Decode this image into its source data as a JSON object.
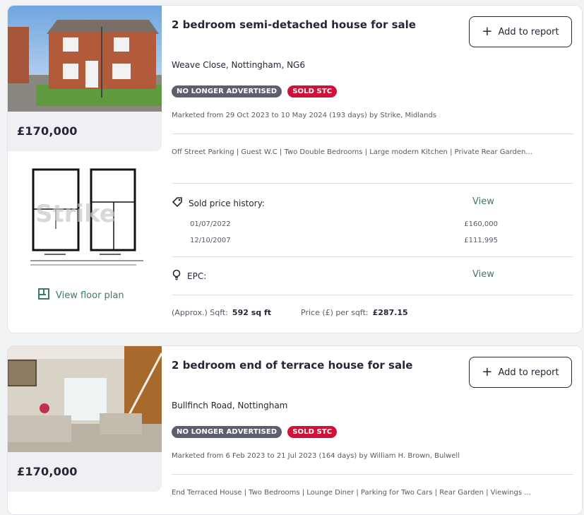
{
  "listings": [
    {
      "title": "2 bedroom semi-detached house for sale",
      "add_button": "Add to report",
      "address": "Weave Close, Nottingham, NG6",
      "badges": [
        "NO LONGER ADVERTISED",
        "SOLD STC"
      ],
      "marketed": "Marketed from 29 Oct 2023 to 10 May 2024 (193 days) by Strike, Midlands",
      "features": "Off Street Parking | Guest W.C | Two Double Bedrooms | Large modern Kitchen | Private Rear Garden...",
      "price": "£170,000",
      "view_floor_plan": "View floor plan",
      "sold_history_label": "Sold price history:",
      "sold_view": "View",
      "sold_history": [
        {
          "date": "01/07/2022",
          "price": "£160,000"
        },
        {
          "date": "12/10/2007",
          "price": "£111,995"
        }
      ],
      "epc_label": "EPC:",
      "epc_view": "View",
      "sqft_label": "(Approx.) Sqft:",
      "sqft_value": "592 sq ft",
      "price_per_sqft_label": "Price (£) per sqft:",
      "price_per_sqft_value": "£287.15",
      "floorplan_watermark": "Strike"
    },
    {
      "title": "2 bedroom end of terrace house for sale",
      "add_button": "Add to report",
      "address": "Bullfinch Road, Nottingham",
      "badges": [
        "NO LONGER ADVERTISED",
        "SOLD STC"
      ],
      "marketed": "Marketed from 6 Feb 2023 to 21 Jul 2023 (164 days) by William H. Brown, Bulwell",
      "features": "End Terraced House | Two Bedrooms | Lounge Diner | Parking for Two Cars | Rear Garden | Viewings ...",
      "price": "£170,000"
    }
  ],
  "colors": {
    "badge_grey": "#5c5f6e",
    "badge_red": "#d0123a",
    "link_teal": "#3a7a6e",
    "text_dark": "#262637"
  }
}
